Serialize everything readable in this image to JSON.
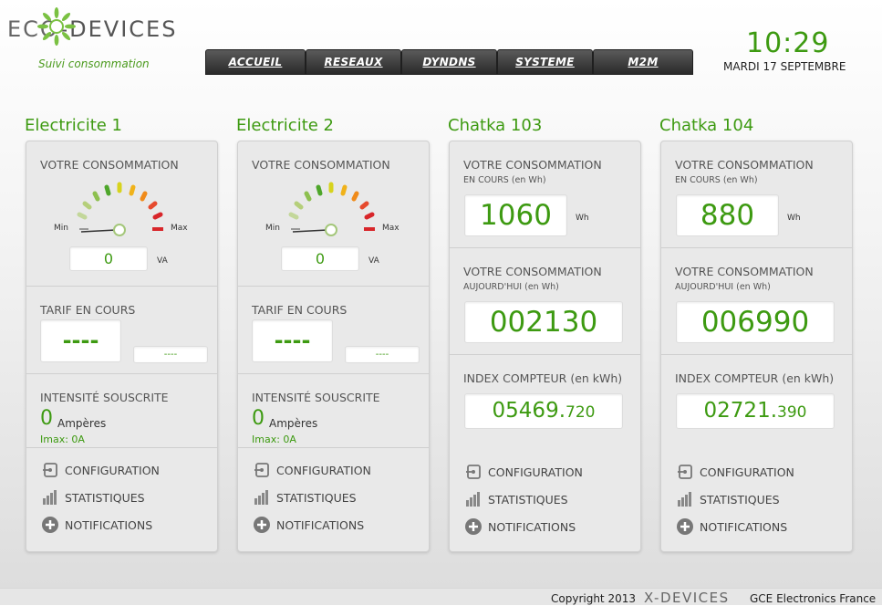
{
  "header": {
    "logo_text_left": "ECO",
    "logo_text_right": "-DEVICES",
    "tagline": "Suivi consommation",
    "time": "10:29",
    "date": "MARDI 17 SEPTEMBRE",
    "nav": [
      "ACCUEIL",
      "RESEAUX",
      "DYNDNS",
      "SYSTEME",
      "M2M"
    ]
  },
  "colors": {
    "accent": "#3d9a11",
    "nav_bg": "#333333"
  },
  "panels": [
    {
      "title": "Electricite 1",
      "type": "electric",
      "consumption_label": "VOTRE CONSOMMATION",
      "gauge_min": "Min",
      "gauge_max": "Max",
      "value": "0",
      "unit": "VA",
      "tarif_label": "TARIF EN COURS",
      "tarif_value": "----",
      "tarif_small": "----",
      "intensity_label": "INTENSITÉ SOUSCRITE",
      "amp_value": "0",
      "amp_unit": "Ampères",
      "imax": "Imax: 0A",
      "links": [
        "CONFIGURATION",
        "STATISTIQUES",
        "NOTIFICATIONS"
      ]
    },
    {
      "title": "Electricite 2",
      "type": "electric",
      "consumption_label": "VOTRE CONSOMMATION",
      "gauge_min": "Min",
      "gauge_max": "Max",
      "value": "0",
      "unit": "VA",
      "tarif_label": "TARIF EN COURS",
      "tarif_value": "----",
      "tarif_small": "----",
      "intensity_label": "INTENSITÉ SOUSCRITE",
      "amp_value": "0",
      "amp_unit": "Ampères",
      "imax": "Imax: 0A",
      "links": [
        "CONFIGURATION",
        "STATISTIQUES",
        "NOTIFICATIONS"
      ]
    },
    {
      "title": "Chatka 103",
      "type": "counter",
      "consumption_label": "VOTRE CONSOMMATION",
      "current_sub": "EN COURS (en Wh)",
      "current_value": "1060",
      "current_unit": "Wh",
      "today_label": "VOTRE CONSOMMATION",
      "today_sub": "AUJOURD'HUI (en Wh)",
      "today_value": "002130",
      "index_label": "INDEX COMPTEUR (en kWh)",
      "index_int": "05469.",
      "index_dec": "720",
      "links": [
        "CONFIGURATION",
        "STATISTIQUES",
        "NOTIFICATIONS"
      ]
    },
    {
      "title": "Chatka 104",
      "type": "counter",
      "consumption_label": "VOTRE CONSOMMATION",
      "current_sub": "EN COURS (en Wh)",
      "current_value": "880",
      "current_unit": "Wh",
      "today_label": "VOTRE CONSOMMATION",
      "today_sub": "AUJOURD'HUI (en Wh)",
      "today_value": "006990",
      "index_label": "INDEX COMPTEUR (en kWh)",
      "index_int": "02721.",
      "index_dec": "390",
      "links": [
        "CONFIGURATION",
        "STATISTIQUES",
        "NOTIFICATIONS"
      ]
    }
  ],
  "footer": {
    "copyright": "Copyright 2013",
    "brand": "X-DEVICES",
    "company": "GCE Electronics France"
  }
}
